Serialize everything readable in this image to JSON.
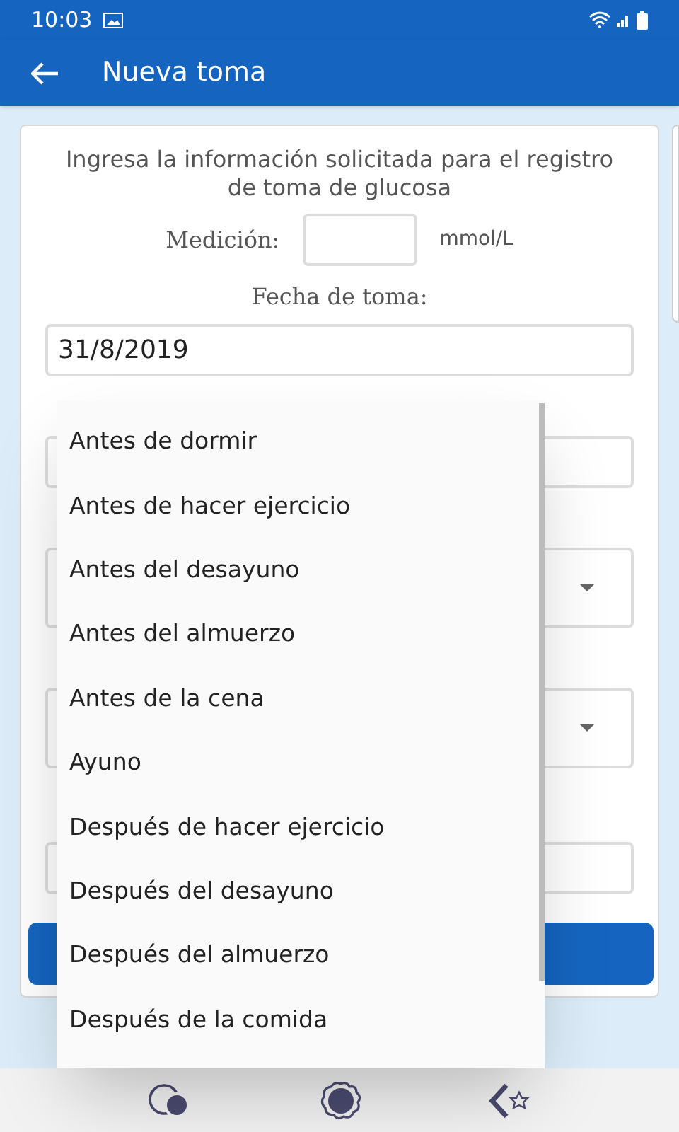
{
  "status_bar": {
    "time": "10:03"
  },
  "app_bar": {
    "title": "Nueva toma"
  },
  "form": {
    "intro": "Ingresa la información solicitada para el registro de toma de glucosa",
    "measurement_label": "Medición:",
    "measurement_unit": "mmol/L",
    "date_label": "Fecha de toma:",
    "date_value": "31/8/2019",
    "fields": [
      {
        "kind": "input"
      },
      {
        "kind": "select"
      },
      {
        "kind": "select"
      },
      {
        "kind": "input"
      }
    ]
  },
  "dropdown": {
    "options": [
      {
        "label": "Antes de dormir",
        "selected": false
      },
      {
        "label": "Antes de hacer ejercicio",
        "selected": false
      },
      {
        "label": "Antes del desayuno",
        "selected": false
      },
      {
        "label": "Antes del almuerzo",
        "selected": false
      },
      {
        "label": "Antes de la cena",
        "selected": false
      },
      {
        "label": "Ayuno",
        "selected": false
      },
      {
        "label": "Después de hacer ejercicio",
        "selected": false
      },
      {
        "label": "Después del desayuno",
        "selected": false
      },
      {
        "label": "Después del almuerzo",
        "selected": false
      },
      {
        "label": "Después de la comida",
        "selected": false
      }
    ]
  }
}
